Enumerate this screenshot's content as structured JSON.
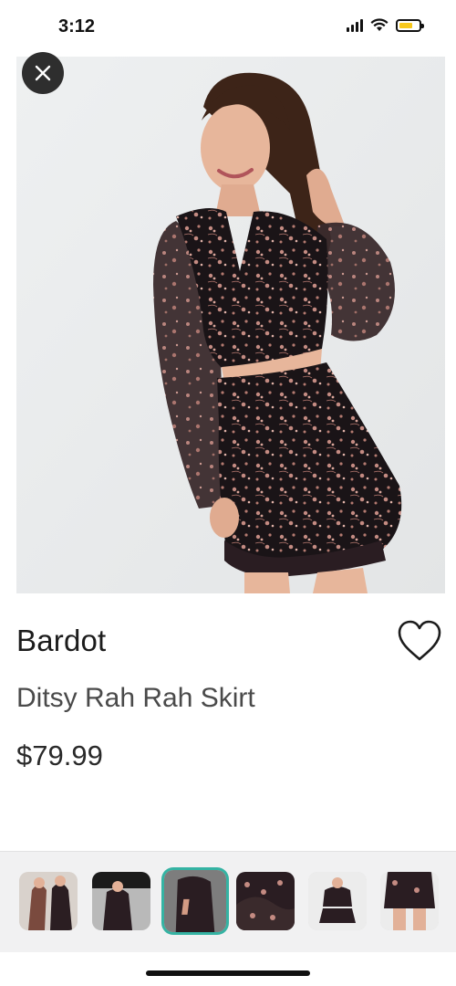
{
  "status_bar": {
    "time": "3:12",
    "icons": [
      "signal-icon",
      "wifi-icon",
      "battery-charging-icon"
    ],
    "battery_level": 0.6
  },
  "product": {
    "brand": "Bardot",
    "name": "Ditsy Rah Rah Skirt",
    "price": "$79.99",
    "image": "model-wearing-floral-wrap-top-and-ruffle-skirt"
  },
  "thumbnails": {
    "count": 6,
    "selected_index": 2,
    "selected_color": "#35b3a3"
  },
  "colors": {
    "close_button_bg": "#2e2e2e",
    "photo_background": "#eceeef",
    "fabric": "#1a1417",
    "print": "#c48b82"
  }
}
